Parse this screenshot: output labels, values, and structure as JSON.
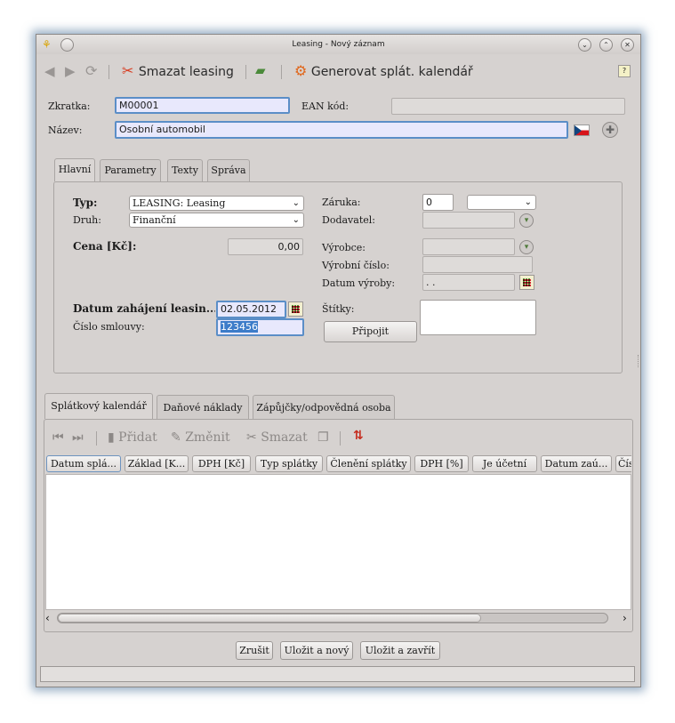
{
  "window": {
    "title": "Leasing - Nový záznam"
  },
  "toolbar": {
    "delete_label": "Smazat leasing",
    "generate_label": "Generovat splát. kalendář"
  },
  "header": {
    "code_label": "Zkratka:",
    "code_value": "M00001",
    "ean_label": "EAN kód:",
    "ean_value": "",
    "name_label": "Název:",
    "name_value": "Osobní automobil"
  },
  "tabs_top": [
    "Hlavní",
    "Parametry",
    "Texty",
    "Správa"
  ],
  "main": {
    "type_label": "Typ:",
    "type_value": "LEASING: Leasing",
    "kind_label": "Druh:",
    "kind_value": "Finanční",
    "price_label": "Cena [Kč]:",
    "price_value": "0,00",
    "start_label": "Datum zahájení leasin...",
    "start_value": "02.05.2012",
    "contract_label": "Číslo smlouvy:",
    "contract_value": "123456",
    "warranty_label": "Záruka:",
    "warranty_value": "0",
    "warranty_unit": "",
    "supplier_label": "Dodavatel:",
    "manufacturer_label": "Výrobce:",
    "serial_label": "Výrobní číslo:",
    "mfg_date_label": "Datum výroby:",
    "mfg_date_value": ". .",
    "tags_label": "Štítky:",
    "attach_button": "Připojit"
  },
  "tabs_bottom": [
    "Splátkový kalendář",
    "Daňové náklady",
    "Zápůjčky/odpovědná osoba"
  ],
  "grid_toolbar": {
    "add": "Přidat",
    "edit": "Změnit",
    "delete": "Smazat"
  },
  "grid_columns": [
    "Datum splá...",
    "Základ [K...",
    "DPH [Kč]",
    "Typ splátky",
    "Členění splátky",
    "DPH [%]",
    "Je účetní",
    "Datum zaú...",
    "Čís"
  ],
  "footer": {
    "cancel": "Zrušit",
    "save_new": "Uložit a nový",
    "save_close": "Uložit a zavřít"
  },
  "colors": {
    "focus_border": "#5b8ec7",
    "focus_fill": "#e8e8fc",
    "selection": "#3d7cc9",
    "window_bg": "#d6d2d0"
  }
}
